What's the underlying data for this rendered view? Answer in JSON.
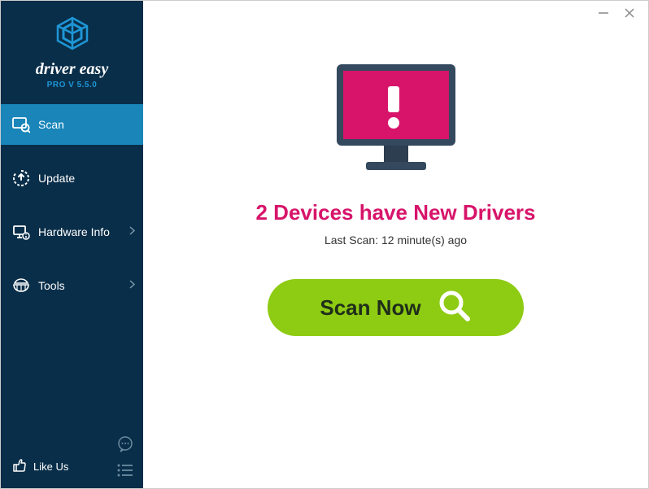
{
  "window": {
    "minimize_title": "Minimize",
    "close_title": "Close"
  },
  "sidebar": {
    "logo_text": "driver easy",
    "version": "PRO V 5.5.0",
    "items": [
      {
        "label": "Scan",
        "icon": "scan-icon",
        "active": true,
        "has_submenu": false
      },
      {
        "label": "Update",
        "icon": "update-icon",
        "active": false,
        "has_submenu": false
      },
      {
        "label": "Hardware Info",
        "icon": "hardware-info-icon",
        "active": false,
        "has_submenu": true
      },
      {
        "label": "Tools",
        "icon": "tools-icon",
        "active": false,
        "has_submenu": true
      }
    ],
    "like_us_label": "Like Us"
  },
  "main": {
    "headline": "2 Devices have New Drivers",
    "last_scan": "Last Scan: 12 minute(s) ago",
    "scan_button_label": "Scan Now"
  }
}
